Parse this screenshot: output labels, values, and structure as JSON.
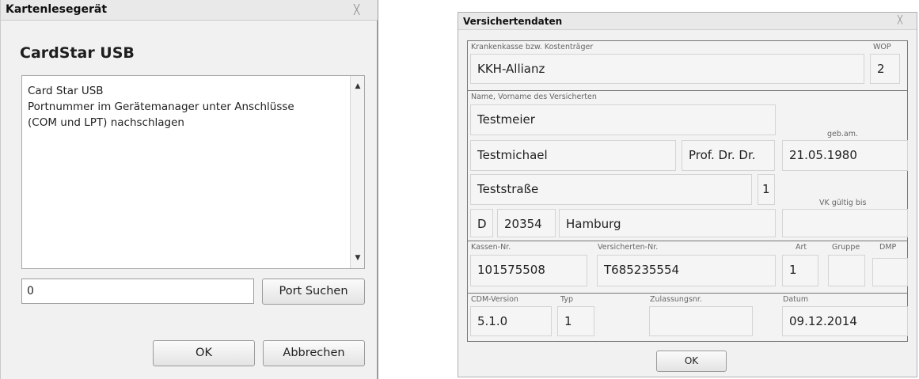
{
  "reader_dialog": {
    "title": "Kartenlesegerät",
    "close_icon": "close-icon",
    "heading": "CardStar USB",
    "info_text": "Card Star USB\nPortnummer im Gerätemanager unter Anschlüsse\n(COM und LPT) nachschlagen",
    "scroll_up": "▲",
    "scroll_down": "▼",
    "port_value": "0",
    "port_search_label": "Port Suchen",
    "ok_label": "OK",
    "cancel_label": "Abbrechen"
  },
  "insured_dialog": {
    "title": "Versichertendaten",
    "close_icon": "close-icon",
    "insurer_label": "Krankenkasse bzw. Kostenträger",
    "wop_label": "WOP",
    "insurer": "KKH-Allianz",
    "wop": "2",
    "name_label": "Name, Vorname des Versicherten",
    "last_name": "Testmeier",
    "birth_label": "geb.am.",
    "first_name": "Testmichael",
    "title_value": "Prof. Dr. Dr.",
    "birth_date": "21.05.1980",
    "street": "Teststraße",
    "house_no": "1",
    "valid_label": "VK gültig bis",
    "country": "D",
    "zip": "20354",
    "city": "Hamburg",
    "valid_until": "",
    "kassen_label": "Kassen-Nr.",
    "versnr_label": "Versicherten-Nr.",
    "art_label": "Art",
    "gruppe_label": "Gruppe",
    "dmp_label": "DMP",
    "kassen_nr": "101575508",
    "vers_nr": "T685235554",
    "art": "1",
    "gruppe": "",
    "dmp": "",
    "cdm_label": "CDM-Version",
    "typ_label": "Typ",
    "zul_label": "Zulassungsnr.",
    "datum_label": "Datum",
    "cdm_version": "5.1.0",
    "typ": "1",
    "zulassungsnr": "",
    "datum": "09.12.2014",
    "ok_label": "OK"
  }
}
